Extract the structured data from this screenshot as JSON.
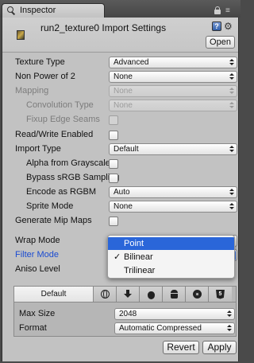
{
  "tab": {
    "title": "Inspector"
  },
  "header": {
    "title": "run2_texture0 Import Settings",
    "open_label": "Open",
    "help_glyph": "?",
    "gear_glyph": "⚙"
  },
  "rows": [
    {
      "label": "Texture Type",
      "control": "dropdown",
      "value": "Advanced"
    },
    {
      "label": "Non Power of 2",
      "control": "dropdown",
      "value": "None"
    },
    {
      "label": "Mapping",
      "control": "dropdown",
      "value": "None",
      "disabled": true
    },
    {
      "label": "Convolution Type",
      "control": "dropdown",
      "value": "None",
      "disabled": true,
      "indent": true
    },
    {
      "label": "Fixup Edge Seams",
      "control": "checkbox",
      "disabled": true,
      "indent": true
    },
    {
      "label": "Read/Write Enabled",
      "control": "checkbox"
    },
    {
      "label": "Import Type",
      "control": "dropdown",
      "value": "Default"
    },
    {
      "label": "Alpha from Grayscale",
      "control": "checkbox",
      "indent": true
    },
    {
      "label": "Bypass sRGB Sampling",
      "control": "checkbox",
      "indent": true
    },
    {
      "label": "Encode as RGBM",
      "control": "dropdown",
      "value": "Auto",
      "indent": true
    },
    {
      "label": "Sprite Mode",
      "control": "dropdown",
      "value": "None",
      "indent": true
    },
    {
      "label": "Generate Mip Maps",
      "control": "checkbox"
    },
    {
      "label": "Wrap Mode",
      "control": "dropdown",
      "value": ""
    },
    {
      "label": "Filter Mode",
      "control": "dropdown",
      "value": "",
      "active": true
    },
    {
      "label": "Aniso Level",
      "control": "none"
    }
  ],
  "platform": {
    "tabs": {
      "default": "Default",
      "icons": [
        "globe-icon",
        "download-icon",
        "apple-icon",
        "android-icon",
        "blackberry-icon",
        "html5-icon"
      ],
      "html5_glyph": "5"
    },
    "max_size": {
      "label": "Max Size",
      "value": "2048"
    },
    "format": {
      "label": "Format",
      "value": "Automatic Compressed"
    }
  },
  "buttons": {
    "revert": "Revert",
    "apply": "Apply"
  },
  "popup": {
    "items": [
      {
        "label": "Point",
        "highlighted": true,
        "checked": false
      },
      {
        "label": "Bilinear",
        "highlighted": false,
        "checked": true
      },
      {
        "label": "Trilinear",
        "highlighted": false,
        "checked": false
      }
    ],
    "check_glyph": "✓"
  },
  "colors": {
    "panel_bg": "#c2c2c2",
    "highlight": "#2a66d9",
    "active_label": "#1a4bd1"
  }
}
